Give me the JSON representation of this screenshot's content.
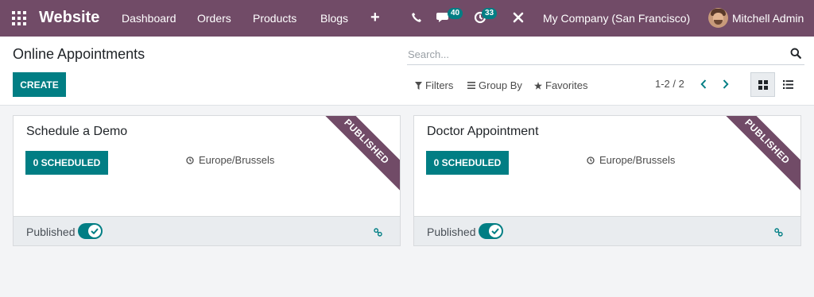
{
  "navbar": {
    "brand": "Website",
    "menu": [
      "Dashboard",
      "Orders",
      "Products",
      "Blogs"
    ],
    "plus_label": "+",
    "messages_count": "40",
    "activities_count": "33",
    "company": "My Company (San Francisco)",
    "user": "Mitchell Admin",
    "bg_color": "#714b67"
  },
  "control_panel": {
    "title": "Online Appointments",
    "search_placeholder": "Search...",
    "create_label": "CREATE",
    "filters_label": "Filters",
    "group_by_label": "Group By",
    "favorites_label": "Favorites",
    "pager": "1-2 / 2",
    "accent_color": "#017e84"
  },
  "cards": [
    {
      "title": "Schedule a Demo",
      "scheduled_label": "0 SCHEDULED",
      "timezone": "Europe/Brussels",
      "ribbon": "PUBLISHED",
      "published_label": "Published",
      "published": true
    },
    {
      "title": "Doctor Appointment",
      "scheduled_label": "0 SCHEDULED",
      "timezone": "Europe/Brussels",
      "ribbon": "PUBLISHED",
      "published_label": "Published",
      "published": true
    }
  ]
}
